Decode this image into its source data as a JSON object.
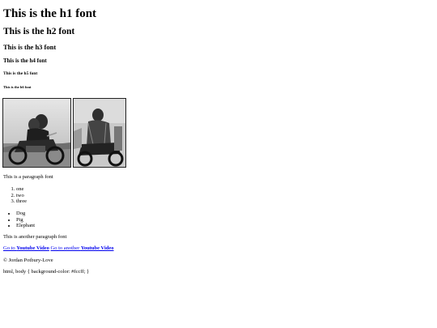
{
  "headings": {
    "h1": "This is the h1 font",
    "h2": "This is the h2 font",
    "h3": "This is the h3 font",
    "h4": "This is the h4 font",
    "h5": "This is the h5 font",
    "h6": "This is the h6 font"
  },
  "paragraph1": "This is a paragraph font",
  "ordered_list": [
    "one",
    "two",
    "three"
  ],
  "unordered_list": [
    "Dog",
    "Pig",
    "Elephant"
  ],
  "paragraph2": "This is another paragraph font",
  "links": {
    "link1_prefix": "Go to ",
    "link1_bold": "Youtube Video",
    "link2_prefix": "Go to another ",
    "link2_bold": "Youtube Video"
  },
  "copyright": "© Jordan Potbury-Love",
  "css_text": "html, body { background-color: #fccff; }"
}
